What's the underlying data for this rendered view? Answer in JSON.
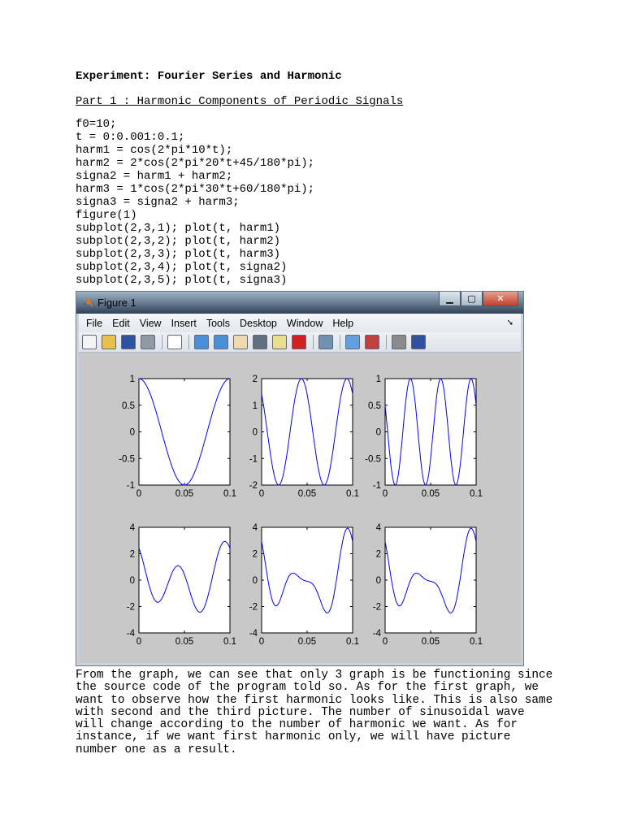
{
  "document": {
    "heading": "Experiment: Fourier Series and Harmonic",
    "part_title": "Part 1 : Harmonic Components of Periodic Signals",
    "code_lines": [
      "f0=10;",
      "t = 0:0.001:0.1;",
      "harm1 = cos(2*pi*10*t);",
      "harm2 = 2*cos(2*pi*20*t+45/180*pi);",
      "signa2 = harm1 + harm2;",
      "harm3 = 1*cos(2*pi*30*t+60/180*pi);",
      "signa3 = signa2 + harm3;",
      "figure(1)",
      "subplot(2,3,1); plot(t, harm1)",
      "subplot(2,3,2); plot(t, harm2)",
      "subplot(2,3,3); plot(t, harm3)",
      "subplot(2,3,4); plot(t, signa2)",
      "subplot(2,3,5); plot(t, signa3)"
    ],
    "paragraph_lines": [
      "From the graph, we can see that only 3 graph is be functioning since",
      "the source code of the program told so. As for the first graph, we",
      "want to observe how the first harmonic looks like. This is also same",
      "with second and the third picture. The number of sinusoidal wave",
      "will change according to the number of harmonic we want. As for",
      "instance, if we want first harmonic only, we will have picture",
      "number one as a result."
    ]
  },
  "figure_window": {
    "title": "Figure 1",
    "menu": [
      "File",
      "Edit",
      "View",
      "Insert",
      "Tools",
      "Desktop",
      "Window",
      "Help"
    ],
    "toolbar_icons": [
      "new-file-icon",
      "open-folder-icon",
      "save-icon",
      "print-icon",
      "|",
      "pointer-icon",
      "|",
      "zoom-in-icon",
      "zoom-out-icon",
      "pan-hand-icon",
      "rotate-3d-icon",
      "data-cursor-icon",
      "brush-icon",
      "|",
      "link-plot-icon",
      "|",
      "colorbar-icon",
      "legend-icon",
      "|",
      "hide-plot-tools-icon",
      "show-plot-tools-icon"
    ],
    "line_color": "#0000ff"
  },
  "chart_data": [
    {
      "type": "line",
      "name": "harm1",
      "xlim": [
        0,
        0.1
      ],
      "ylim": [
        -1,
        1
      ],
      "xticks": [
        "0",
        "0.05",
        "0.1"
      ],
      "yticks": [
        "1",
        "0.5",
        "0",
        "-0.5",
        "-1"
      ],
      "components": [
        {
          "amp": 1,
          "freq": 10,
          "phase_deg": 0
        }
      ]
    },
    {
      "type": "line",
      "name": "harm2",
      "xlim": [
        0,
        0.1
      ],
      "ylim": [
        -2,
        2
      ],
      "xticks": [
        "0",
        "0.05",
        "0.1"
      ],
      "yticks": [
        "2",
        "1",
        "0",
        "-1",
        "-2"
      ],
      "components": [
        {
          "amp": 2,
          "freq": 20,
          "phase_deg": 45
        }
      ]
    },
    {
      "type": "line",
      "name": "harm3",
      "xlim": [
        0,
        0.1
      ],
      "ylim": [
        -1,
        1
      ],
      "xticks": [
        "0",
        "0.05",
        "0.1"
      ],
      "yticks": [
        "1",
        "0.5",
        "0",
        "-0.5",
        "-1"
      ],
      "components": [
        {
          "amp": 1,
          "freq": 30,
          "phase_deg": 60
        }
      ]
    },
    {
      "type": "line",
      "name": "signa2",
      "xlim": [
        0,
        0.1
      ],
      "ylim": [
        -4,
        4
      ],
      "xticks": [
        "0",
        "0.05",
        "0.1"
      ],
      "yticks": [
        "4",
        "2",
        "0",
        "-2",
        "-4"
      ],
      "components": [
        {
          "amp": 1,
          "freq": 10,
          "phase_deg": 0
        },
        {
          "amp": 2,
          "freq": 20,
          "phase_deg": 45
        }
      ]
    },
    {
      "type": "line",
      "name": "signa3",
      "xlim": [
        0,
        0.1
      ],
      "ylim": [
        -4,
        4
      ],
      "xticks": [
        "0",
        "0.05",
        "0.1"
      ],
      "yticks": [
        "4",
        "2",
        "0",
        "-2",
        "-4"
      ],
      "components": [
        {
          "amp": 1,
          "freq": 10,
          "phase_deg": 0
        },
        {
          "amp": 2,
          "freq": 20,
          "phase_deg": 45
        },
        {
          "amp": 1,
          "freq": 30,
          "phase_deg": 60
        }
      ]
    },
    {
      "type": "line",
      "name": "signa3",
      "xlim": [
        0,
        0.1
      ],
      "ylim": [
        -4,
        4
      ],
      "xticks": [
        "0",
        "0.05",
        "0.1"
      ],
      "yticks": [
        "4",
        "2",
        "0",
        "-2",
        "-4"
      ],
      "components": [
        {
          "amp": 1,
          "freq": 10,
          "phase_deg": 0
        },
        {
          "amp": 2,
          "freq": 20,
          "phase_deg": 45
        },
        {
          "amp": 1,
          "freq": 30,
          "phase_deg": 60
        }
      ]
    }
  ]
}
